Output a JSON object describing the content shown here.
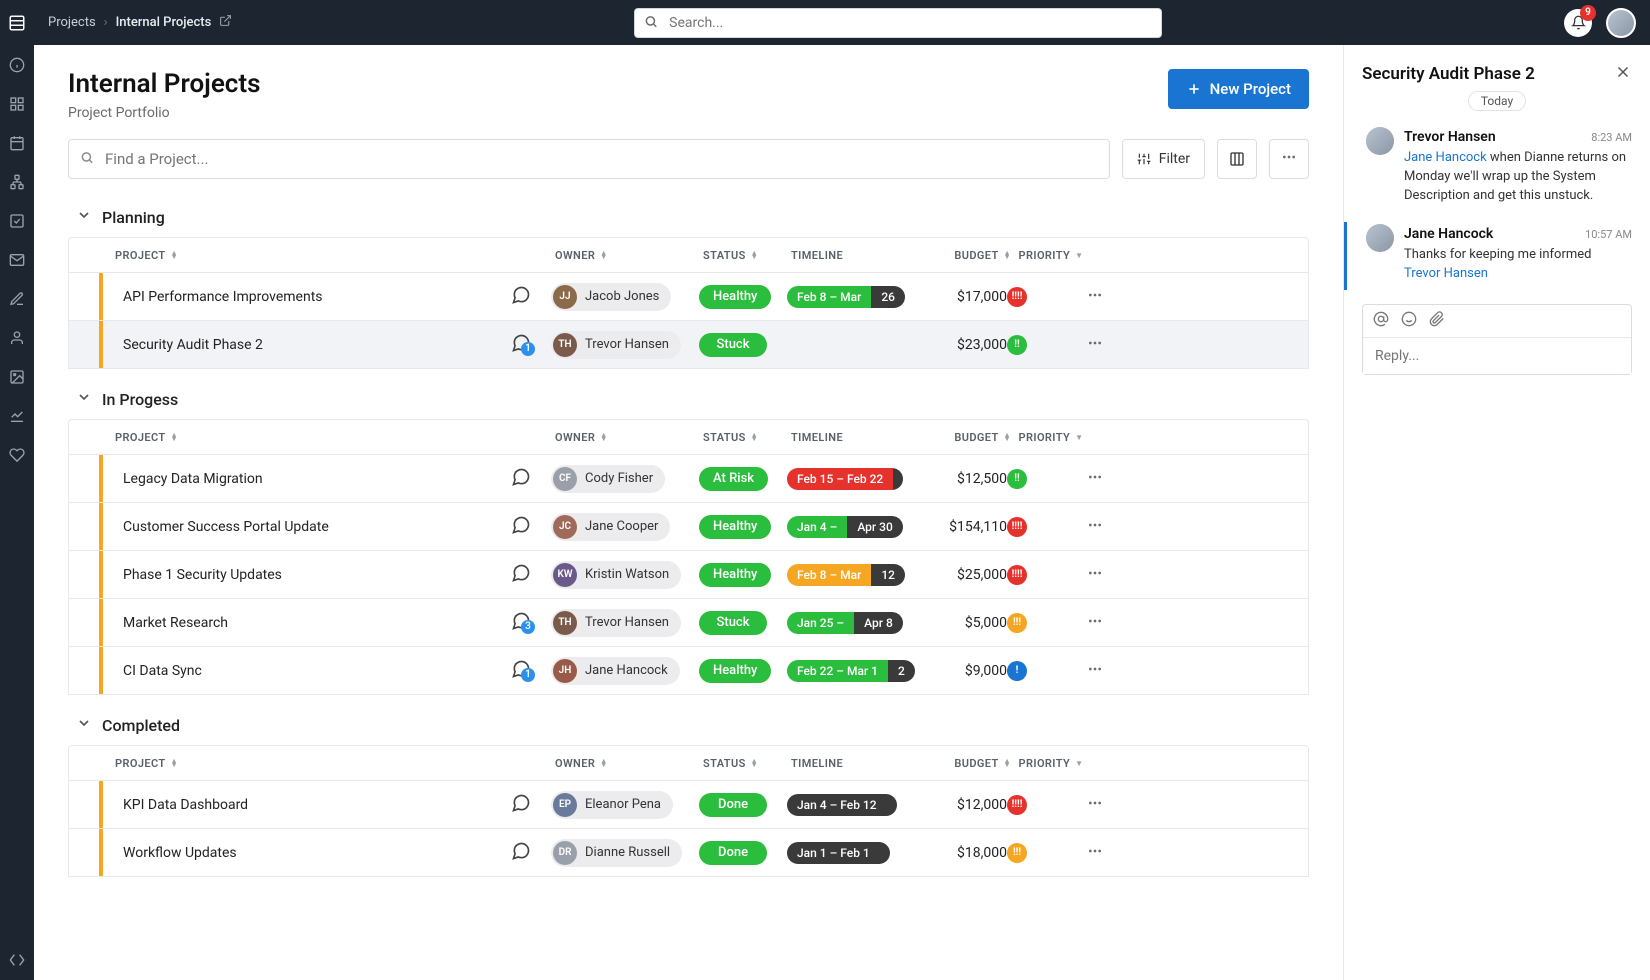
{
  "breadcrumbs": {
    "root": "Projects",
    "current": "Internal Projects"
  },
  "search": {
    "placeholder": "Search..."
  },
  "notifications": {
    "count": "9"
  },
  "page": {
    "title": "Internal Projects",
    "subtitle": "Project Portfolio"
  },
  "actions": {
    "new_project": "New Project",
    "filter": "Filter",
    "find_placeholder": "Find a Project..."
  },
  "columns": {
    "project": "PROJECT",
    "owner": "OWNER",
    "status": "STATUS",
    "timeline": "TIMELINE",
    "budget": "BUDGET",
    "priority": "PRIORITY"
  },
  "sections": [
    {
      "name": "Planning",
      "rows": [
        {
          "project": "API Performance Improvements",
          "comments": 0,
          "owner": "Jacob Jones",
          "initials": "JJ",
          "avatar_color": "#8a6a4a",
          "status": "Healthy",
          "status_color": "#2bbd3d",
          "timeline_a": "Feb 8 – Mar",
          "timeline_b": "26",
          "tl_a_color": "#2bbd3d",
          "tl_b_color": "#3a3a3a",
          "budget": "$17,000",
          "priority_color": "#e5322c",
          "priority_glyph": "!!!!"
        },
        {
          "project": "Security Audit Phase 2",
          "selected": true,
          "comments": 1,
          "owner": "Trevor Hansen",
          "initials": "TH",
          "avatar_color": "#7a5a4a",
          "status": "Stuck",
          "status_color": "#2bbd3d",
          "timeline_a": "",
          "timeline_b": "",
          "tl_a_color": "",
          "tl_b_color": "",
          "budget": "$23,000",
          "priority_color": "#2bbd3d",
          "priority_glyph": "!!"
        }
      ]
    },
    {
      "name": "In Progess",
      "rows": [
        {
          "project": "Legacy Data Migration",
          "comments": 0,
          "owner": "Cody Fisher",
          "initials": "CF",
          "avatar_color": "#9aa0a9",
          "status": "At Risk",
          "status_color": "#2bbd3d",
          "timeline_a": "Feb 15 – Feb 22",
          "timeline_b": "",
          "tl_a_color": "#e5322c",
          "tl_b_color": "#3a3a3a",
          "budget": "$12,500",
          "priority_color": "#2bbd3d",
          "priority_glyph": "!!"
        },
        {
          "project": "Customer Success Portal Update",
          "comments": 0,
          "owner": "Jane Cooper",
          "initials": "JC",
          "avatar_color": "#a06a5a",
          "status": "Healthy",
          "status_color": "#2bbd3d",
          "timeline_a": "Jan 4 – ",
          "timeline_b": "Apr 30",
          "tl_a_color": "#2bbd3d",
          "tl_b_color": "#3a3a3a",
          "budget": "$154,110",
          "priority_color": "#e5322c",
          "priority_glyph": "!!!!"
        },
        {
          "project": "Phase 1 Security Updates",
          "comments": 0,
          "owner": "Kristin Watson",
          "initials": "KW",
          "avatar_color": "#6a5a8a",
          "status": "Healthy",
          "status_color": "#2bbd3d",
          "timeline_a": "Feb 8 – Mar",
          "timeline_b": "12",
          "tl_a_color": "#f5a623",
          "tl_b_color": "#3a3a3a",
          "budget": "$25,000",
          "priority_color": "#e5322c",
          "priority_glyph": "!!!!"
        },
        {
          "project": "Market Research",
          "comments": 3,
          "owner": "Trevor Hansen",
          "initials": "TH",
          "avatar_color": "#7a5a4a",
          "status": "Stuck",
          "status_color": "#2bbd3d",
          "timeline_a": "Jan 25 – ",
          "timeline_b": "Apr 8",
          "tl_a_color": "#2bbd3d",
          "tl_b_color": "#3a3a3a",
          "budget": "$5,000",
          "priority_color": "#f5a623",
          "priority_glyph": "!!!"
        },
        {
          "project": "CI Data Sync",
          "comments": 1,
          "owner": "Jane Hancock",
          "initials": "JH",
          "avatar_color": "#9a5a4a",
          "status": "Healthy",
          "status_color": "#2bbd3d",
          "timeline_a": "Feb 22 – Mar 1",
          "timeline_b": "2",
          "tl_a_color": "#2bbd3d",
          "tl_b_color": "#3a3a3a",
          "budget": "$9,000",
          "priority_color": "#1a75d2",
          "priority_glyph": "!"
        }
      ]
    },
    {
      "name": "Completed",
      "rows": [
        {
          "project": "KPI Data Dashboard",
          "comments": 0,
          "owner": "Eleanor Pena",
          "initials": "EP",
          "avatar_color": "#6a7a9a",
          "status": "Done",
          "status_color": "#2bbd3d",
          "timeline_a": "Jan 4 – Feb 12",
          "timeline_b": "",
          "tl_a_color": "#3a3a3a",
          "tl_b_color": "#3a3a3a",
          "budget": "$12,000",
          "priority_color": "#e5322c",
          "priority_glyph": "!!!!"
        },
        {
          "project": "Workflow Updates",
          "comments": 0,
          "owner": "Dianne Russell",
          "initials": "DR",
          "avatar_color": "#9aa0a9",
          "status": "Done",
          "status_color": "#2bbd3d",
          "timeline_a": "Jan 1 – Feb 1",
          "timeline_b": "",
          "tl_a_color": "#3a3a3a",
          "tl_b_color": "#3a3a3a",
          "budget": "$18,000",
          "priority_color": "#f5a623",
          "priority_glyph": "!!!"
        }
      ]
    }
  ],
  "sidepanel": {
    "title": "Security Audit Phase 2",
    "today": "Today",
    "reply_placeholder": "Reply...",
    "messages": [
      {
        "author": "Trevor Hansen",
        "time": "8:23 AM",
        "mention": "Jane Hancock",
        "text": " when Dianne returns on Monday we'll wrap up the System Description and get this unstuck."
      },
      {
        "author": "Jane Hancock",
        "time": "10:57 AM",
        "text": "Thanks for keeping me informed ",
        "mention_after": "Trevor Hansen",
        "highlight": true
      }
    ]
  },
  "leftnav_icons": [
    "info",
    "grid",
    "calendar",
    "sitemap",
    "check",
    "mail",
    "edit",
    "user",
    "image",
    "chart",
    "heart"
  ]
}
